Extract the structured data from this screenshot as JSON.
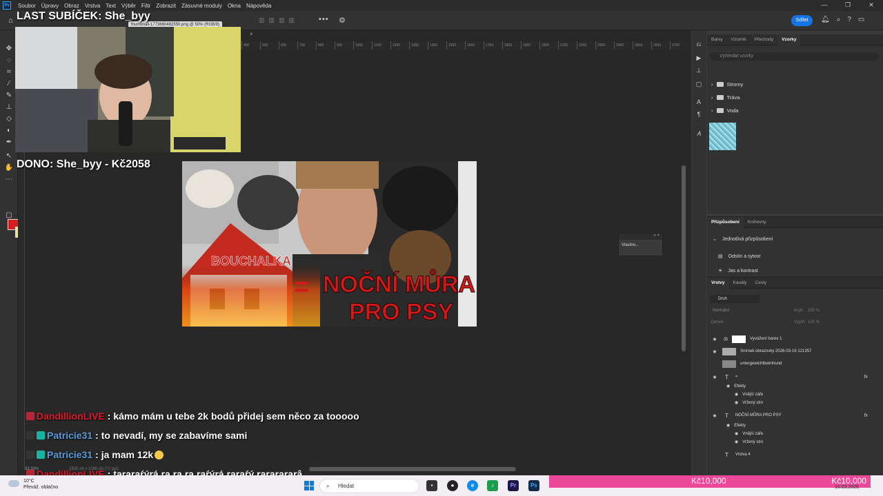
{
  "menu": {
    "items": [
      "Soubor",
      "Úpravy",
      "Obraz",
      "Vrstva",
      "Text",
      "Výběr",
      "Filtr",
      "Zobrazit",
      "Zásuvné moduly",
      "Okna",
      "Nápověda"
    ],
    "window_controls": [
      "—",
      "❐",
      "✕"
    ]
  },
  "optionsbar": {
    "share_label": "Sdílet"
  },
  "document": {
    "tab_title": "thumbnail-1773660482550.png @ 50% (RGB/8)",
    "close": "×"
  },
  "status": {
    "zoom": "33,33%",
    "dimensions": "1920 ob x 1080 ob (72 ppi)"
  },
  "ruler": {
    "ticks": [
      "400",
      "500",
      "600",
      "700",
      "800",
      "900",
      "1000",
      "1100",
      "1200",
      "1300",
      "1400",
      "1500",
      "1600",
      "1700",
      "1800",
      "1900",
      "2000",
      "2100",
      "2200",
      "2300",
      "2400",
      "2500",
      "2600",
      "2700",
      "2800",
      "2900",
      "3000",
      "3100"
    ]
  },
  "overlay": {
    "last_sub": "LAST SUBÍČEK: She_byy",
    "dono": "DONO: She_byy - Kč2058"
  },
  "thumbnail": {
    "label1": "BOUCHALKA",
    "label2": "=",
    "label3": "NOČNÍ MŮRA",
    "label4": "PRO PSY"
  },
  "chat": [
    {
      "user": "DandillionLIVE",
      "message": ": kámo mám u tebe 2k bodů přidej sem něco za tooooo",
      "color": "#e0182b"
    },
    {
      "user": "Patricie31",
      "message": ": to nevadí, my se zabavíme sami",
      "color": "#5b9bd5"
    },
    {
      "user": "Patricie31",
      "message": ": ja mam 12k",
      "color": "#5b9bd5"
    },
    {
      "user": "DandillionLIVE",
      "message": ": tararaŕýrá ra ra ra raŕýrá raraŕý rararararâ",
      "color": "#e0182b"
    }
  ],
  "mini_panel": {
    "label": "Vlastno..."
  },
  "swatches": {
    "tabs": [
      "Barvy",
      "Vzorník",
      "Přechody",
      "Vzorky"
    ],
    "active_tab": "Vzorky",
    "search_placeholder": "Vyhledat vzorky",
    "folders": [
      "Stromy",
      "Tráva",
      "Voda"
    ]
  },
  "adjustments": {
    "tabs": [
      "Přizpůsobení",
      "Knihovny"
    ],
    "section": "Jednotlivá přizpůsobení",
    "items": [
      "Odstín a sytost",
      "Jas a kontrast"
    ]
  },
  "layers": {
    "tabs": [
      "Vrstvy",
      "Kanály",
      "Cesty"
    ],
    "filter": "Druh",
    "blend_mode": "Normální",
    "opacity_label": "Krytí:",
    "opacity_value": "100 %",
    "lock_label": "Zamek:",
    "fill_label": "Výplň:",
    "fill_value": "100 %",
    "items": [
      {
        "name": "Vyvážení barev 1",
        "fx": ""
      },
      {
        "name": "Snímek obrazovky 2026-03-16 121357",
        "fx": ""
      },
      {
        "name": "untergewichtbeimhund",
        "fx": ""
      },
      {
        "name": "=",
        "fx": "fx"
      },
      {
        "name": "Efekty",
        "fx": ""
      },
      {
        "name": "Vnější záře",
        "fx": ""
      },
      {
        "name": "Vržený stín",
        "fx": ""
      },
      {
        "name": "NOČNÍ MŮRA  PRO PSY",
        "fx": "fx"
      },
      {
        "name": "Efekty",
        "fx": ""
      },
      {
        "name": "Vnější záře",
        "fx": ""
      },
      {
        "name": "Vržený stín",
        "fx": ""
      },
      {
        "name": "Vrstva 4",
        "fx": ""
      }
    ]
  },
  "taskbar": {
    "temperature": "10°C",
    "weather": "Převáž. oblačno",
    "search_placeholder": "Hledat",
    "date": "16.03.2026",
    "donation_left": "Kč10,000",
    "donation_right": "Kč10,000"
  }
}
